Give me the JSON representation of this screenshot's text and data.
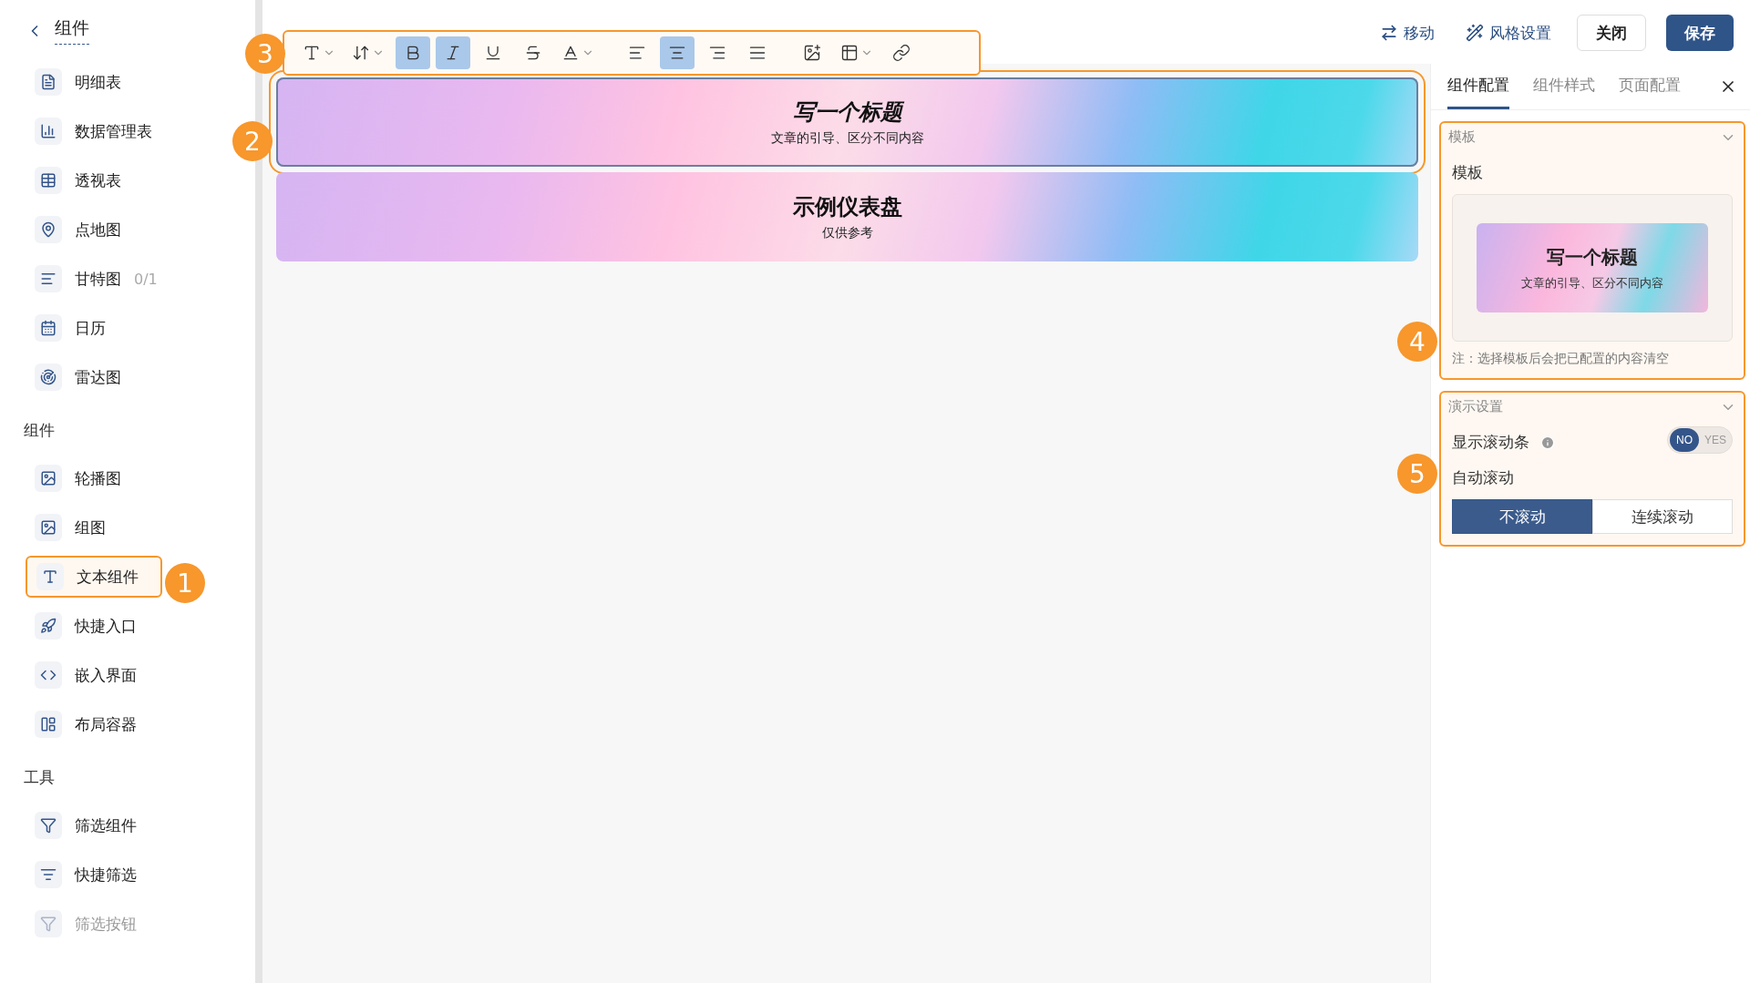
{
  "sidebar": {
    "back_title": "组件",
    "groups": [
      {
        "items": [
          {
            "label": "明细表",
            "selected": false,
            "disabled": false
          },
          {
            "label": "数据管理表",
            "selected": false,
            "disabled": false
          },
          {
            "label": "透视表",
            "selected": false,
            "disabled": false
          },
          {
            "label": "点地图",
            "selected": false,
            "disabled": false
          },
          {
            "label": "甘特图",
            "count": "0/1",
            "selected": false,
            "disabled": false
          },
          {
            "label": "日历",
            "selected": false,
            "disabled": false
          },
          {
            "label": "雷达图",
            "selected": false,
            "disabled": false
          }
        ]
      },
      {
        "heading": "组件",
        "items": [
          {
            "label": "轮播图",
            "selected": false,
            "disabled": false
          },
          {
            "label": "组图",
            "selected": false,
            "disabled": false
          },
          {
            "label": "文本组件",
            "selected": true,
            "disabled": false
          },
          {
            "label": "快捷入口",
            "selected": false,
            "disabled": false
          },
          {
            "label": "嵌入界面",
            "selected": false,
            "disabled": false
          },
          {
            "label": "布局容器",
            "selected": false,
            "disabled": false
          }
        ]
      },
      {
        "heading": "工具",
        "items": [
          {
            "label": "筛选组件",
            "selected": false,
            "disabled": false
          },
          {
            "label": "快捷筛选",
            "selected": false,
            "disabled": false
          },
          {
            "label": "筛选按钮",
            "selected": false,
            "disabled": true
          }
        ]
      }
    ]
  },
  "toolbar": {
    "buttons": [
      {
        "selected": false,
        "dropdown": true
      },
      {
        "selected": false,
        "dropdown": true
      },
      {
        "selected": true,
        "dropdown": false
      },
      {
        "selected": true,
        "dropdown": false
      },
      {
        "selected": false,
        "dropdown": false
      },
      {
        "selected": false,
        "dropdown": false
      },
      {
        "selected": false,
        "dropdown": true
      },
      {
        "selected": false,
        "dropdown": false
      },
      {
        "selected": true,
        "dropdown": false
      },
      {
        "selected": false,
        "dropdown": false
      },
      {
        "selected": false,
        "dropdown": false
      },
      {
        "selected": false,
        "dropdown": false
      },
      {
        "selected": false,
        "dropdown": true
      },
      {
        "selected": false,
        "dropdown": false
      }
    ]
  },
  "header_actions": [
    {
      "kind": "link",
      "label": "移动"
    },
    {
      "kind": "link",
      "label": "风格设置"
    },
    {
      "kind": "button",
      "label": "关闭"
    },
    {
      "kind": "primary",
      "label": "保存"
    }
  ],
  "canvas": {
    "banners": [
      {
        "title": "写一个标题",
        "subtitle": "文章的引导、区分不同内容",
        "selected": true
      },
      {
        "title": "示例仪表盘",
        "subtitle": "仅供参考",
        "selected": false
      }
    ]
  },
  "panel": {
    "tabs": [
      {
        "label": "组件配置",
        "selected": true
      },
      {
        "label": "组件样式",
        "selected": false
      },
      {
        "label": "页面配置",
        "selected": false
      }
    ],
    "template_section": {
      "heading": "模板",
      "label": "模板",
      "preview_title": "写一个标题",
      "preview_subtitle": "文章的引导、区分不同内容",
      "note": "注：选择模板后会把已配置的内容清空"
    },
    "demo_section": {
      "heading": "演示设置",
      "scrollbar_label": "显示滚动条",
      "scrollbar_on": false,
      "off_label": "NO",
      "on_label": "YES",
      "auto_label": "自动滚动",
      "options": [
        {
          "label": "不滚动",
          "selected": true
        },
        {
          "label": "连续滚动",
          "selected": false
        }
      ]
    }
  },
  "callouts": [
    "1",
    "2",
    "3",
    "4",
    "5"
  ]
}
